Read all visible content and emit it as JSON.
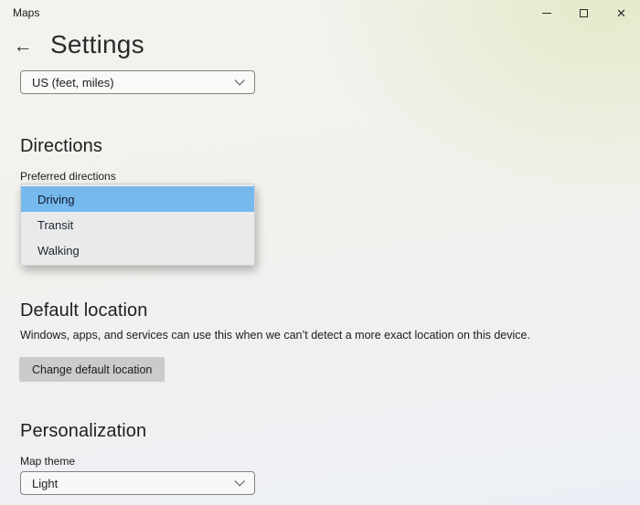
{
  "window": {
    "title": "Maps",
    "close_glyph": "✕"
  },
  "header": {
    "back_glyph": "←",
    "title": "Settings"
  },
  "units_combobox": {
    "value": "US (feet, miles)"
  },
  "directions": {
    "heading": "Directions",
    "label": "Preferred directions",
    "options": [
      {
        "label": "Driving",
        "selected": true
      },
      {
        "label": "Transit",
        "selected": false
      },
      {
        "label": "Walking",
        "selected": false
      }
    ]
  },
  "default_location": {
    "heading": "Default location",
    "description": "Windows, apps, and services can use this when we can’t detect a more exact location on this device.",
    "button_label": "Change default location"
  },
  "personalization": {
    "heading": "Personalization",
    "label": "Map theme",
    "theme_combobox": {
      "value": "Light"
    }
  },
  "colors": {
    "highlight_blue": "#76b9ed",
    "flyout_bg": "#e9eaea",
    "button_gray": "#cbcbc9"
  }
}
